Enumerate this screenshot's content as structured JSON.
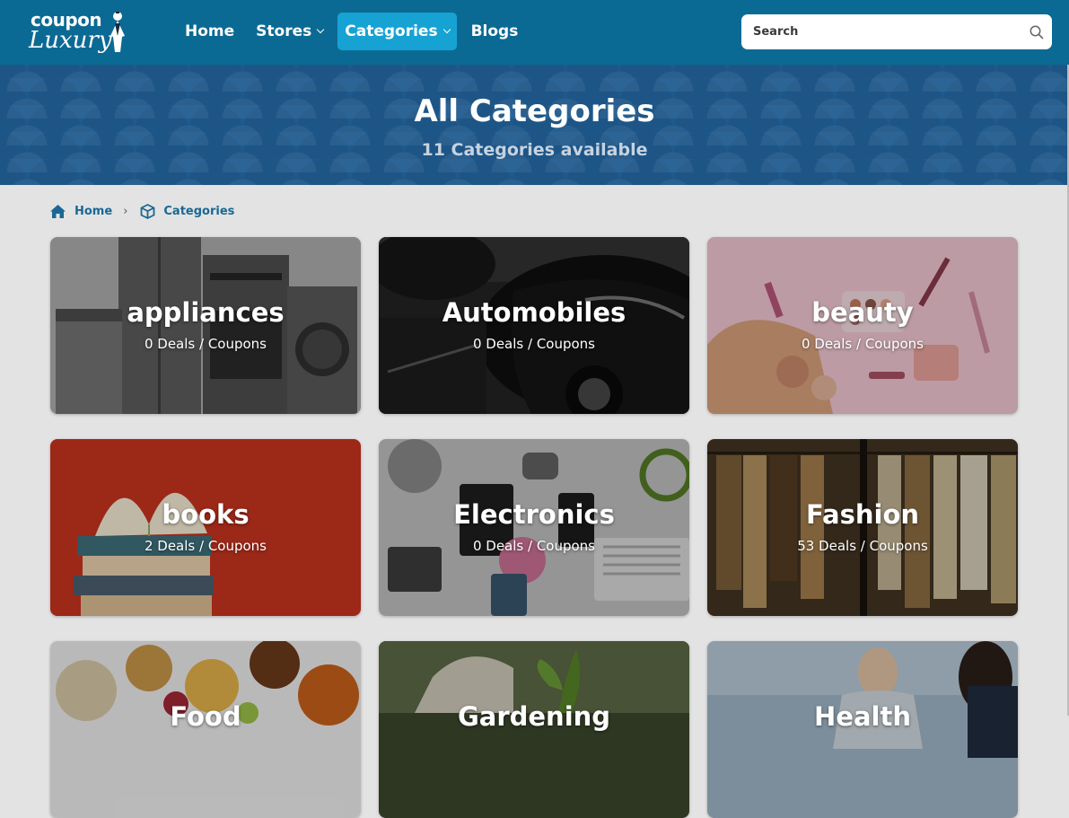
{
  "brand": {
    "logo_top": "coupon",
    "logo_bottom": "Luxury"
  },
  "nav": [
    {
      "label": "Home",
      "dropdown": false,
      "active": false
    },
    {
      "label": "Stores",
      "dropdown": true,
      "active": false
    },
    {
      "label": "Categories",
      "dropdown": true,
      "active": true
    },
    {
      "label": "Blogs",
      "dropdown": false,
      "active": false
    }
  ],
  "search": {
    "placeholder": "Search",
    "icon": "search-icon"
  },
  "hero": {
    "title": "All Categories",
    "subtitle": "11 Categories available"
  },
  "breadcrumb": {
    "home": {
      "label": "Home",
      "icon": "home-icon"
    },
    "separator": "›",
    "current": {
      "label": "Categories",
      "icon": "cube-icon"
    }
  },
  "categories": [
    {
      "name": "appliances",
      "count": "0 Deals / Coupons"
    },
    {
      "name": "Automobiles",
      "count": "0 Deals / Coupons"
    },
    {
      "name": "beauty",
      "count": "0 Deals / Coupons"
    },
    {
      "name": "books",
      "count": "2 Deals / Coupons"
    },
    {
      "name": "Electronics",
      "count": "0 Deals / Coupons"
    },
    {
      "name": "Fashion",
      "count": "53 Deals / Coupons"
    },
    {
      "name": "Food",
      "count": ""
    },
    {
      "name": "Gardening",
      "count": ""
    },
    {
      "name": "Health",
      "count": ""
    }
  ],
  "colors": {
    "header": "#0b6a94",
    "active_nav": "#16a3d3",
    "hero": "#1f5a8e",
    "link": "#1a6893",
    "page_bg": "#e3e3e3"
  }
}
